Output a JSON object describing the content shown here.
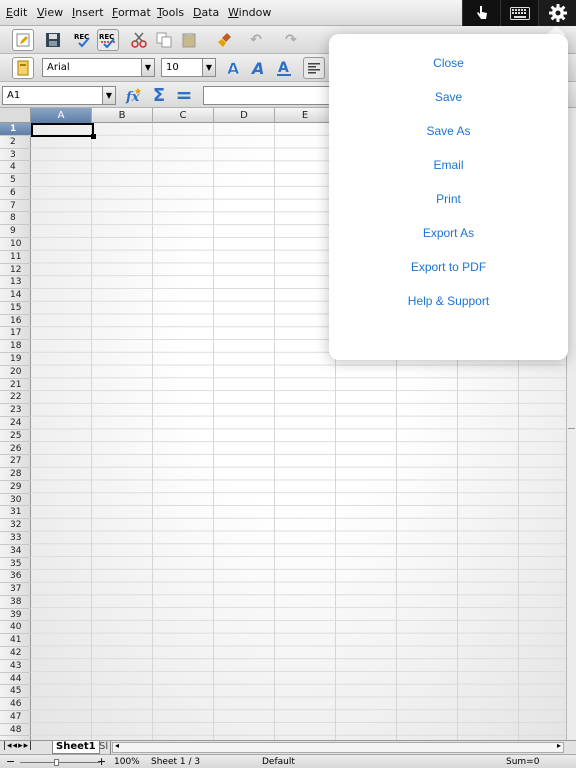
{
  "menubar": {
    "items": [
      "Edit",
      "View",
      "Insert",
      "Format",
      "Tools",
      "Data",
      "Window"
    ]
  },
  "topright": {
    "icons": [
      "touch-icon",
      "keyboard-icon",
      "gear-icon"
    ]
  },
  "formatting": {
    "font_name": "Arial",
    "font_size": "10"
  },
  "formula": {
    "cell_ref": "A1",
    "value": ""
  },
  "grid": {
    "columns": [
      "A",
      "B",
      "C",
      "D",
      "E"
    ],
    "rows": [
      "1",
      "2",
      "3",
      "4",
      "5",
      "6",
      "7",
      "8",
      "9",
      "10",
      "11",
      "12",
      "13",
      "14",
      "15",
      "16",
      "17",
      "18",
      "19",
      "20",
      "21",
      "22",
      "23",
      "24",
      "25",
      "26",
      "27",
      "28",
      "29",
      "30",
      "31",
      "32",
      "33",
      "34",
      "35",
      "36",
      "37",
      "38",
      "39",
      "40",
      "41",
      "42",
      "43",
      "44",
      "45",
      "46",
      "47",
      "48"
    ],
    "selected_column": "A",
    "selected_row": "1"
  },
  "tabs": {
    "items": [
      "Sheet1",
      "Sl"
    ]
  },
  "statusbar": {
    "zoom": "100%",
    "sheet": "Sheet 1 / 3",
    "style": "Default",
    "sum": "Sum=0"
  },
  "popover": {
    "items": [
      "Close",
      "Save",
      "Save As",
      "Email",
      "Print",
      "Export As",
      "Export to PDF",
      "Help & Support"
    ]
  },
  "colors": {
    "accent": "#1a74d6",
    "selection": "#6d89ae"
  }
}
